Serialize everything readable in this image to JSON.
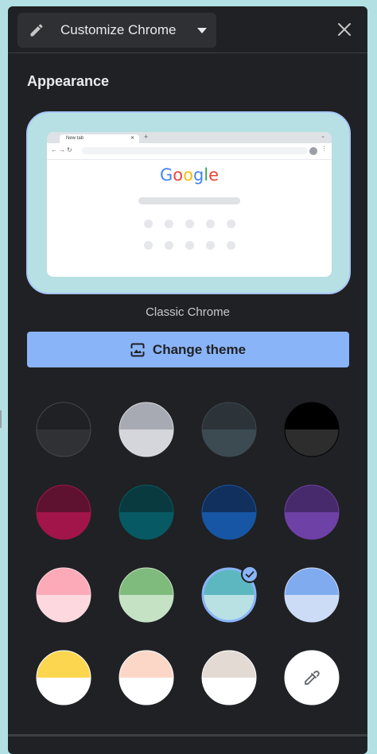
{
  "header": {
    "title": "Customize Chrome",
    "pencil_icon": "pencil-icon",
    "dropdown_icon": "caret-down-icon",
    "close_icon": "close-icon"
  },
  "appearance": {
    "section_title": "Appearance",
    "preview": {
      "tab_title": "New tab",
      "logo": [
        "G",
        "o",
        "o",
        "g",
        "l",
        "e"
      ],
      "logo_colors": [
        "#4285f4",
        "#ea4335",
        "#fbbc05",
        "#4285f4",
        "#34a853",
        "#ea4335"
      ]
    },
    "theme_name": "Classic Chrome",
    "change_theme_label": "Change theme",
    "change_theme_icon": "image-icon"
  },
  "swatches": [
    {
      "id": "default-dark",
      "top": "#202124",
      "bottom": "#2f3134",
      "border": "#45474a",
      "selected": false
    },
    {
      "id": "grey",
      "top": "#a8aab3",
      "bottom": "#d5d6dc",
      "border": "#dadce0",
      "selected": false
    },
    {
      "id": "slate",
      "top": "#2c3439",
      "bottom": "#3c4a52",
      "border": "#3c4a52",
      "selected": false
    },
    {
      "id": "black",
      "top": "#000000",
      "bottom": "#2d2d2d",
      "border": "#000000",
      "selected": false
    },
    {
      "id": "maroon",
      "top": "#5f1230",
      "bottom": "#a2154a",
      "border": "#a2154a",
      "selected": false
    },
    {
      "id": "teal-dark",
      "top": "#083a40",
      "bottom": "#075a63",
      "border": "#075a63",
      "selected": false
    },
    {
      "id": "navy",
      "top": "#11305e",
      "bottom": "#1656a5",
      "border": "#1656a5",
      "selected": false
    },
    {
      "id": "purple",
      "top": "#472a6b",
      "bottom": "#6e41a6",
      "border": "#6e41a6",
      "selected": false
    },
    {
      "id": "pink",
      "top": "#fdaab8",
      "bottom": "#fdd9df",
      "border": "#fdd9df",
      "selected": false
    },
    {
      "id": "green",
      "top": "#7fbb7c",
      "bottom": "#c6e2c5",
      "border": "#c6e2c5",
      "selected": false
    },
    {
      "id": "aqua",
      "top": "#5db7c0",
      "bottom": "#b9e1e4",
      "border": "#8ab4f8",
      "selected": true
    },
    {
      "id": "blue",
      "top": "#80abef",
      "bottom": "#cddcf6",
      "border": "#cddcf6",
      "selected": false
    },
    {
      "id": "yellow",
      "top": "#fdd64f",
      "bottom": "#ffffff",
      "border": "#ffffff",
      "selected": false
    },
    {
      "id": "peach",
      "top": "#fcd7c8",
      "bottom": "#ffffff",
      "border": "#ffffff",
      "selected": false
    },
    {
      "id": "beige",
      "top": "#e3dad4",
      "bottom": "#ffffff",
      "border": "#ffffff",
      "selected": false
    },
    {
      "id": "custom",
      "top": "#ffffff",
      "bottom": "#ffffff",
      "border": "#ffffff",
      "selected": false,
      "icon": "eyedropper-icon"
    }
  ]
}
